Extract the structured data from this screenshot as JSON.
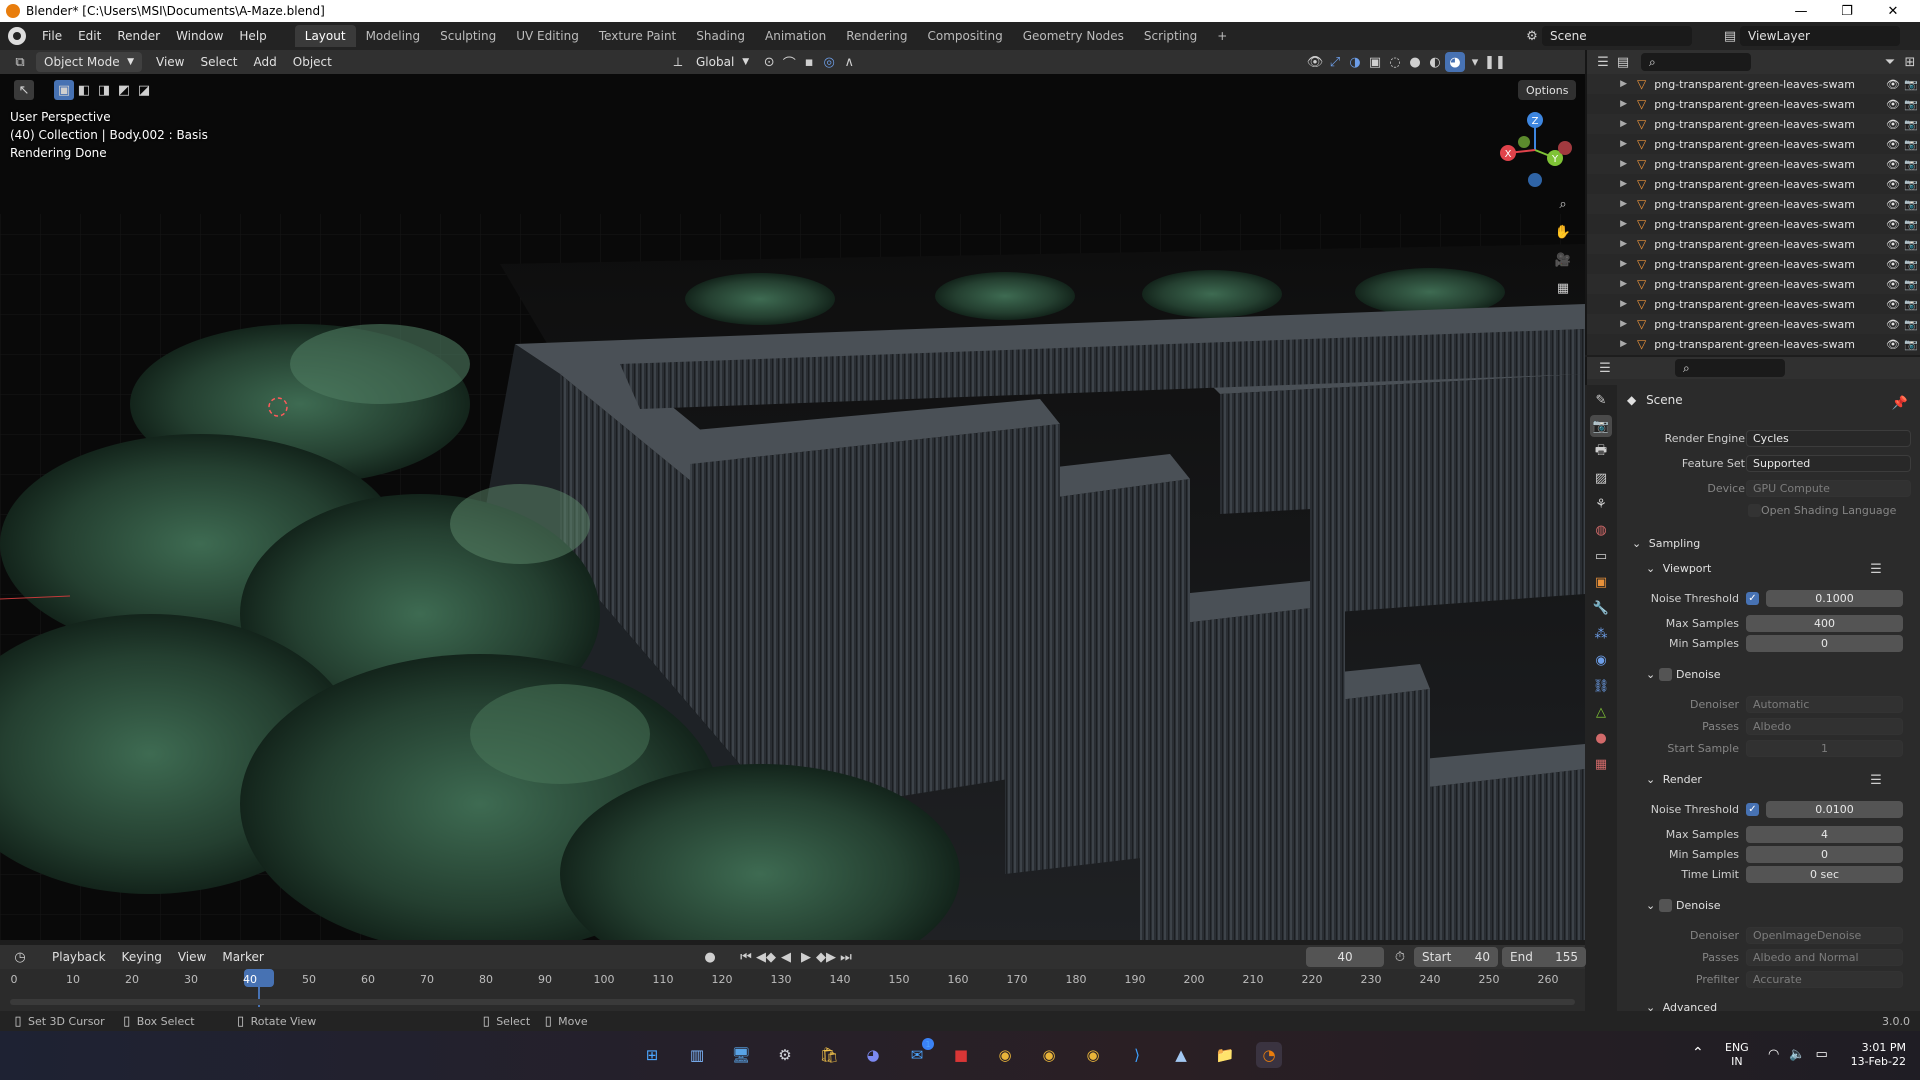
{
  "window": {
    "title": "Blender* [C:\\Users\\MSI\\Documents\\A-Maze.blend]",
    "minimize": "—",
    "maximize": "❐",
    "close": "✕"
  },
  "menu": [
    "File",
    "Edit",
    "Render",
    "Window",
    "Help"
  ],
  "workspaces": [
    "Layout",
    "Modeling",
    "Sculpting",
    "UV Editing",
    "Texture Paint",
    "Shading",
    "Animation",
    "Rendering",
    "Compositing",
    "Geometry Nodes",
    "Scripting"
  ],
  "active_workspace": "Layout",
  "add_workspace": "+",
  "scene_name": "Scene",
  "view_layer": "ViewLayer",
  "viewport_header": {
    "mode": "Object Mode",
    "menus": [
      "View",
      "Select",
      "Add",
      "Object"
    ],
    "transform_orientation": "Global",
    "options": "Options"
  },
  "viewport_overlay": {
    "line1": "User Perspective",
    "line2": "(40) Collection | Body.002 : Basis",
    "line3": "Rendering Done"
  },
  "gizmo": {
    "z": "Z",
    "y": "Y",
    "x": "X"
  },
  "outliner": {
    "item_label": "png-transparent-green-leaves-swam",
    "count": 14
  },
  "properties": {
    "scene_label": "Scene",
    "render_engine_label": "Render Engine",
    "render_engine": "Cycles",
    "feature_set_label": "Feature Set",
    "feature_set": "Supported",
    "device_label": "Device",
    "device": "GPU Compute",
    "osl_label": "Open Shading Language",
    "sampling": "Sampling",
    "viewport": {
      "header": "Viewport",
      "noise_threshold_label": "Noise Threshold",
      "noise_threshold": "0.1000",
      "max_samples_label": "Max Samples",
      "max_samples": "400",
      "min_samples_label": "Min Samples",
      "min_samples": "0",
      "denoise": "Denoise",
      "denoiser_label": "Denoiser",
      "denoiser": "Automatic",
      "passes_label": "Passes",
      "passes": "Albedo",
      "start_sample_label": "Start Sample",
      "start_sample": "1"
    },
    "render": {
      "header": "Render",
      "noise_threshold_label": "Noise Threshold",
      "noise_threshold": "0.0100",
      "max_samples_label": "Max Samples",
      "max_samples": "4",
      "min_samples_label": "Min Samples",
      "min_samples": "0",
      "time_limit_label": "Time Limit",
      "time_limit": "0 sec",
      "denoise": "Denoise",
      "denoiser_label": "Denoiser",
      "denoiser": "OpenImageDenoise",
      "passes_label": "Passes",
      "passes": "Albedo and Normal",
      "prefilter_label": "Prefilter",
      "prefilter": "Accurate"
    },
    "advanced": "Advanced"
  },
  "timeline": {
    "menus": [
      "Playback",
      "Keying",
      "View",
      "Marker"
    ],
    "current_frame": "40",
    "start_label": "Start",
    "start": "40",
    "end_label": "End",
    "end": "155",
    "ticks": [
      "0",
      "10",
      "20",
      "30",
      "40",
      "50",
      "60",
      "70",
      "80",
      "90",
      "100",
      "110",
      "120",
      "130",
      "140",
      "150",
      "160",
      "170",
      "180",
      "190",
      "200",
      "210",
      "220",
      "230",
      "240",
      "250",
      "260"
    ]
  },
  "statusbar": {
    "set_cursor": "Set 3D Cursor",
    "box_select": "Box Select",
    "rotate_view": "Rotate View",
    "select": "Select",
    "move": "Move",
    "version": "3.0.0"
  },
  "taskbar": {
    "lang1": "ENG",
    "lang2": "IN",
    "time": "3:01 PM",
    "date": "13-Feb-22",
    "mail_badge": "1"
  },
  "colors": {
    "accent": "#4772b3",
    "blender_orange": "#e87d0d",
    "axis_x": "#e0434b",
    "axis_y": "#7fc336",
    "axis_z": "#3d86e0"
  }
}
